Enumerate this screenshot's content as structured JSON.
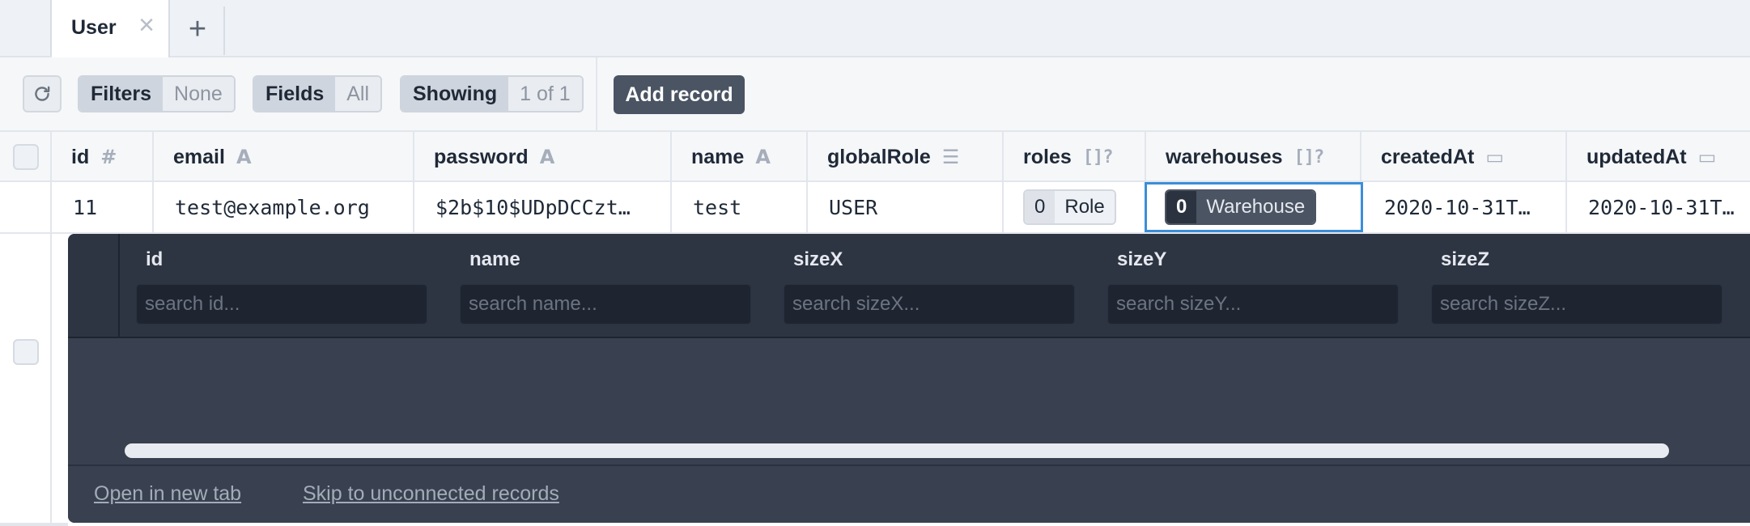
{
  "tabs": [
    {
      "label": "User",
      "close_icon": "close-icon"
    }
  ],
  "tab_add_icon": "plus-icon",
  "toolbar": {
    "refresh_icon": "refresh-icon",
    "filters": {
      "label": "Filters",
      "value": "None"
    },
    "fields": {
      "label": "Fields",
      "value": "All"
    },
    "showing": {
      "label": "Showing",
      "value": "1 of 1"
    },
    "add_record_label": "Add record"
  },
  "columns": [
    {
      "label": "id",
      "type_icon": "#"
    },
    {
      "label": "email",
      "type_icon": "A"
    },
    {
      "label": "password",
      "type_icon": "A"
    },
    {
      "label": "name",
      "type_icon": "A"
    },
    {
      "label": "globalRole",
      "type_icon": "☰"
    },
    {
      "label": "roles",
      "type_icon": "[]?"
    },
    {
      "label": "warehouses",
      "type_icon": "[]?"
    },
    {
      "label": "createdAt",
      "type_icon": "▭"
    },
    {
      "label": "updatedAt",
      "type_icon": "▭"
    }
  ],
  "row": {
    "id": "11",
    "email": "test@example.org",
    "password": "$2b$10$UDpDCCzt…",
    "name": "test",
    "globalRole": "USER",
    "roles": {
      "count": "0",
      "label": "Role"
    },
    "warehouses": {
      "count": "0",
      "label": "Warehouse"
    },
    "createdAt": "2020-10-31T…",
    "updatedAt": "2020-10-31T…"
  },
  "related_panel": {
    "columns": [
      {
        "label": "id",
        "placeholder": "search id..."
      },
      {
        "label": "name",
        "placeholder": "search name..."
      },
      {
        "label": "sizeX",
        "placeholder": "search sizeX..."
      },
      {
        "label": "sizeY",
        "placeholder": "search sizeY..."
      },
      {
        "label": "sizeZ",
        "placeholder": "search sizeZ..."
      }
    ],
    "links": {
      "open_new_tab": "Open in new tab",
      "skip": "Skip to unconnected records"
    }
  },
  "colors": {
    "accent_selected": "#3b8ed8",
    "panel_bg": "#394150",
    "button_dark": "#4a5463"
  }
}
